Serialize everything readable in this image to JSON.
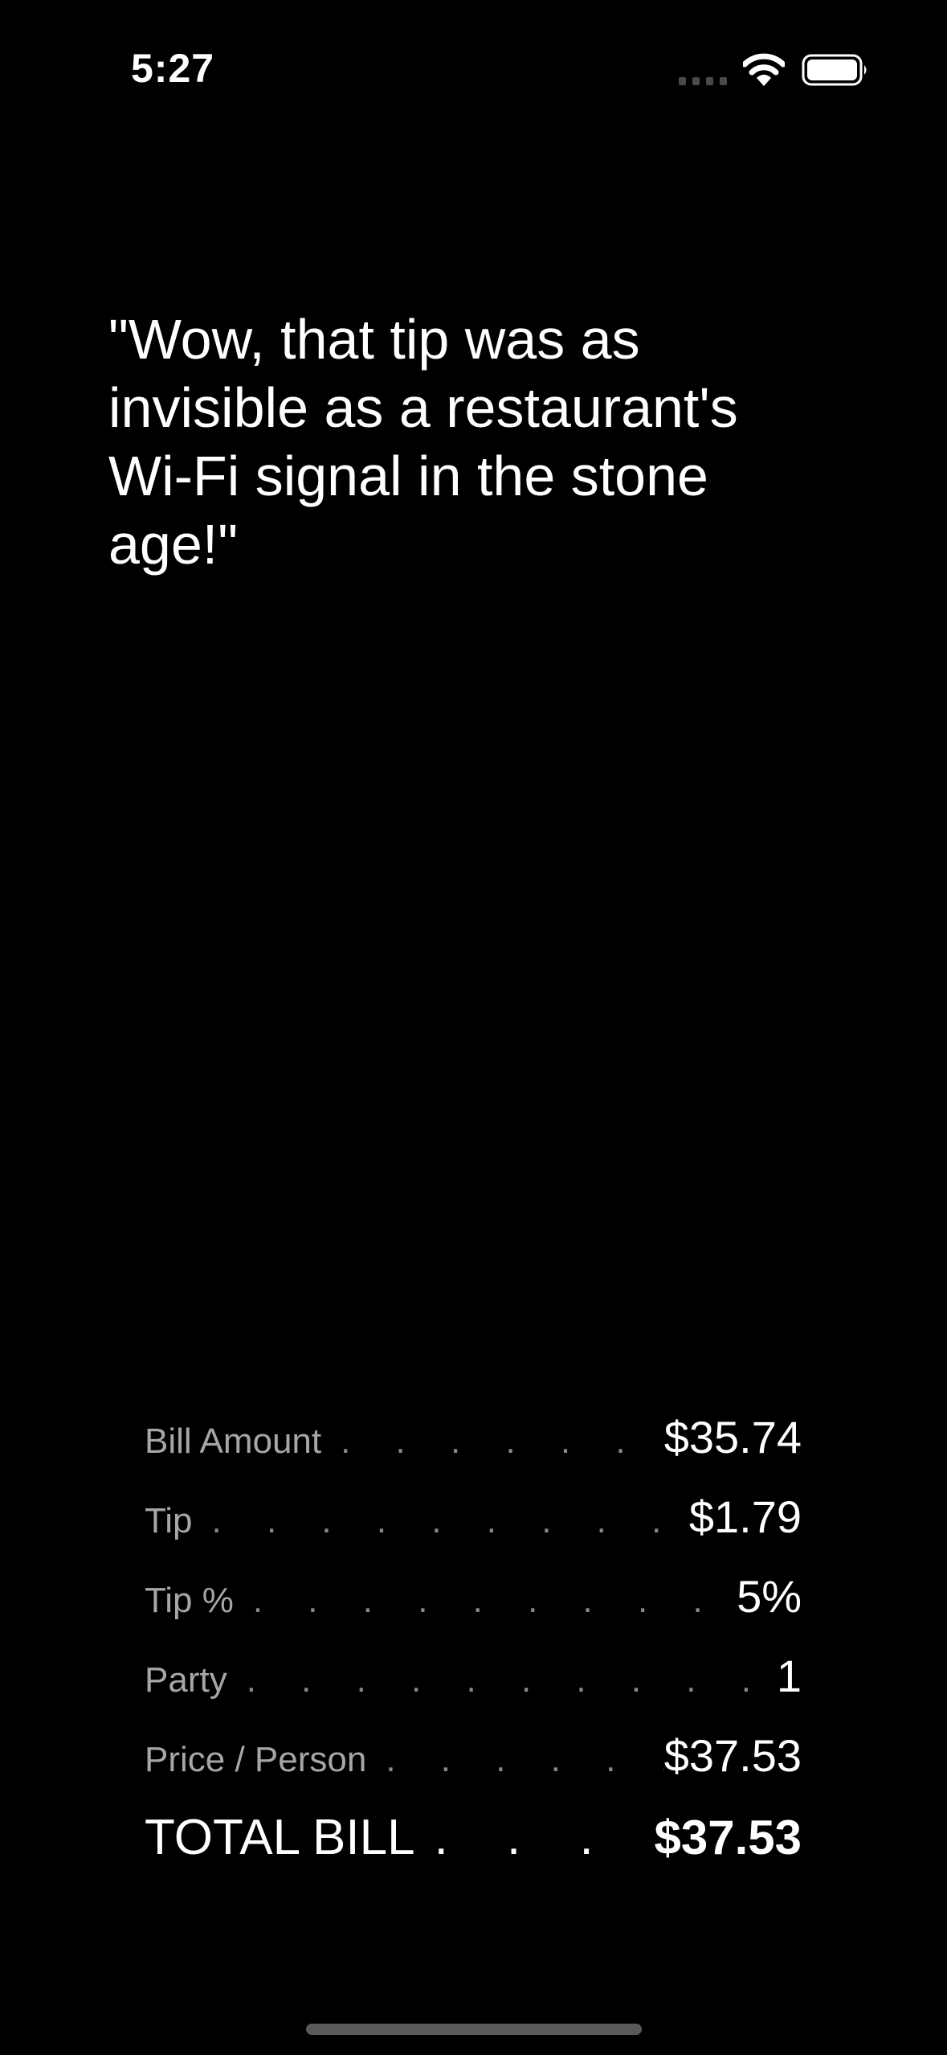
{
  "status_bar": {
    "time": "5:27",
    "icons": [
      "signal-dots-icon",
      "wifi-icon",
      "battery-icon"
    ]
  },
  "quote": {
    "text": "\"Wow, that tip was as invisible as a restaurant's Wi-Fi signal in the stone age!\""
  },
  "summary": {
    "dots": ". . . . . . . . . . . . . . . . . . . . . . . . . . . . . . . . . . . . . . . .",
    "bill_amount": {
      "label": "Bill Amount",
      "value": "$35.74"
    },
    "tip": {
      "label": "Tip",
      "value": "$1.79"
    },
    "tip_percent": {
      "label": "Tip %",
      "value": "5%"
    },
    "party": {
      "label": "Party",
      "value": "1"
    },
    "price_per_person": {
      "label": "Price / Person",
      "value": "$37.53"
    },
    "total_bill": {
      "label": "TOTAL BILL",
      "value": "$37.53"
    }
  },
  "colors": {
    "background": "#000000",
    "text_primary": "#ffffff",
    "text_secondary": "#a6a6a6",
    "home_indicator": "#5a5a5a"
  }
}
